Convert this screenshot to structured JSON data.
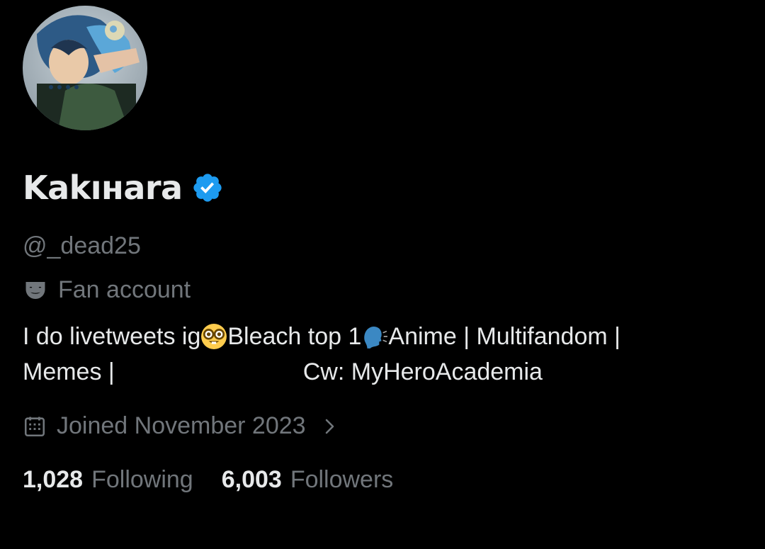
{
  "profile": {
    "display_name": "Kakıнara",
    "verified_icon": "verified-badge-icon",
    "handle": "@_dead25",
    "category": {
      "icon": "theater-masks-icon",
      "label": "Fan account"
    },
    "bio": {
      "line1_part1": "I do livetweets ig",
      "line1_emoji1": "nerd-face-emoji",
      "line1_part2": " Bleach top 1",
      "line1_emoji2": "speaking-head-emoji",
      "line1_part3": " Anime | Multifandom |",
      "line2_part1": "Memes |",
      "line2_part2": "Cw: MyHeroAcademia"
    },
    "joined": {
      "icon": "calendar-icon",
      "label": "Joined November 2023"
    },
    "stats": {
      "following_count": "1,028",
      "following_label": "Following",
      "followers_count": "6,003",
      "followers_label": "Followers"
    }
  },
  "colors": {
    "background": "#000000",
    "primary_text": "#e7e9ea",
    "secondary_text": "#71767b",
    "verified_blue": "#1d9bf0"
  }
}
